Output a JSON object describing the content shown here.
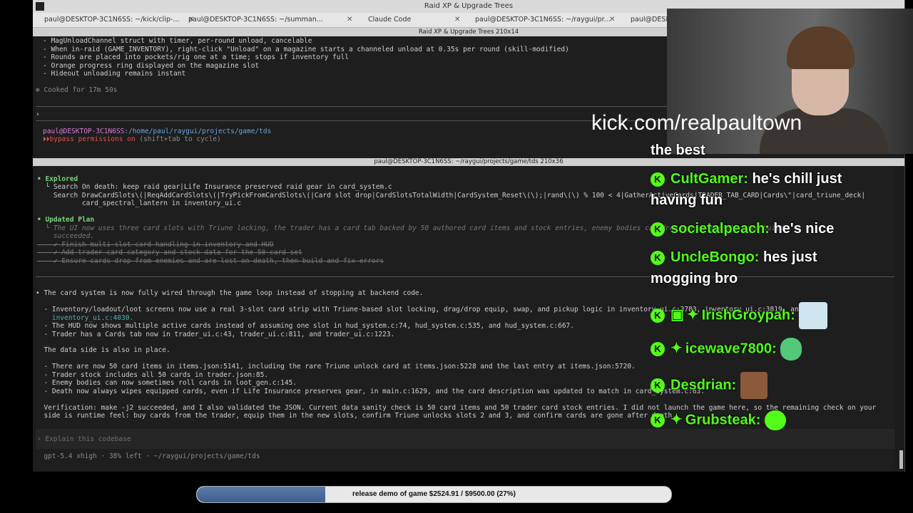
{
  "window": {
    "title": "Raid XP & Upgrade Trees"
  },
  "tabs": [
    {
      "label": "paul@DESKTOP-3C1N6SS: ~/kick/clip-..."
    },
    {
      "label": "paul@DESKTOP-3C1N6SS: ~/summan..."
    },
    {
      "label": "Claude Code"
    },
    {
      "label": "paul@DESKTOP-3C1N6SS: ~/raygui/pr..."
    },
    {
      "label": "paul@DESKTOP-3C1N6SS"
    }
  ],
  "top_pane": {
    "title": "Raid XP & Upgrade Trees 210x14",
    "lines": [
      "- MagUnloadChannel struct with timer, per-round unload, cancelable",
      "- When in-raid (GAME_INVENTORY), right-click \"Unload\" on a magazine starts a channeled unload at 0.35s per round (skill-modified)",
      "- Rounds are placed into pockets/rig one at a time; stops if inventory full",
      "- Orange progress ring displayed on the magazine slot",
      "- Hideout unloading remains instant"
    ],
    "cooked": "✻ Cooked for 17m 50s",
    "caret": "›",
    "prompt_user": "paul@DESKTOP-3C1N6SS",
    "prompt_path": ":/home/paul/raygui/projects/game/tds",
    "bypass": "bypass permissions on",
    "bypass_hint": " (shift+tab to cycle)"
  },
  "bottom_pane": {
    "title": "paul@DESKTOP-3C1N6SS: ~/raygui/projects/game/tds 210x36",
    "explored_header": "• Explored",
    "explored": [
      "  └ Search On death: keep raid gear|Life Insurance preserved raid gear in card_system.c",
      "    Search DrawCardSlots\\(|ReqAddCardSlots\\(|TryPickFromCardSlots\\(|Card slot drop|CardSlotsTotalWidth|CardSystem_Reset\\(\\);|rand\\(\\) % 100 < 4|GatherActiveCards|TRADER_TAB_CARD|Cards\\\"|card_triune_deck|",
      "           card_spectral_lantern in inventory_ui.c"
    ],
    "plan_header": "• Updated Plan",
    "plan_note": "  └ The UI now uses three card slots with Triune locking, the trader has a card tab backed by 50 authored card items and stock entries, enemy bodies can drop cards, and the game build",
    "plan_note2": "    succeeded.",
    "plan_items": [
      "    ✔ Finish multi-slot card handling in inventory and HUD",
      "    ✔ Add trader card category and stock data for the 50-card set",
      "    ✔ Ensure cards drop from enemies and are lost on death, then build and fix errors"
    ],
    "summary": [
      "• The card system is now fully wired through the game loop instead of stopping at backend code.",
      "",
      "  - Inventory/loadout/loot screens now use a real 3-slot card strip with Triune-based slot locking, drag/drop equip, swap, and pickup logic in inventory_ui.c:3783, inventory_ui.c:3819, and",
      "    inventory_ui.c:4030.",
      "  - The HUD now shows multiple active cards instead of assuming one slot in hud_system.c:74, hud_system.c:535, and hud_system.c:667.",
      "  - Trader has a Cards tab now in trader_ui.c:43, trader_ui.c:811, and trader_ui.c:1223.",
      "",
      "  The data side is also in place.",
      "",
      "  - There are now 50 card items in items.json:5141, including the rare Triune unlock card at items.json:5228 and the last entry at items.json:5720.",
      "  - Trader stock includes all 50 cards in trader.json:85.",
      "  - Enemy bodies can now sometimes roll cards in loot_gen.c:145.",
      "  - Death now always wipes equipped cards, even if Life Insurance preserves gear, in main.c:1629, and the card description was updated to match in card_system.c:63.",
      "",
      "  Verification: make -j2 succeeded, and I also validated the JSON. Current data sanity check is 50 card items and 50 trader card stock entries. I did not launch the game here, so the remaining check on your",
      "  side is runtime feel: buy cards from the trader, equip them in the new slots, confirm Triune unlocks slots 2 and 3, and confirm cards are gone after death."
    ],
    "input_placeholder": "› Explain this codebase",
    "status": "  gpt-5.4 xhigh · 38% left · ~/raygui/projects/game/tds"
  },
  "overlay": {
    "watermark": "kick.com/realpaultown",
    "chat": [
      {
        "user": "",
        "message": "the best",
        "continuation": true
      },
      {
        "user": "CultGamer:",
        "message": "he's chill just",
        "message2": "having fun"
      },
      {
        "user": "societalpeach:",
        "message": "he's nice"
      },
      {
        "user": "UncleBongo:",
        "message": "hes just",
        "message2": "mogging bro"
      },
      {
        "user": "IrishGroypah:",
        "message": "",
        "emote": "bunny-emote"
      },
      {
        "user": "icewave7800:",
        "message": "",
        "emote": "wave-hand-emote"
      },
      {
        "user": "Desdrian:",
        "message": "",
        "emote": "laughing-man-emote"
      },
      {
        "user": "Grubsteak:",
        "message": "",
        "emote": "smiling-blob-emote"
      }
    ],
    "progress": {
      "label": "release demo of game $2524.91 / $9500.00 (27%)",
      "fraction": 0.27
    }
  },
  "colors": {
    "kick_green": "#53fc18",
    "progress_fill": "#4a6a9e"
  }
}
